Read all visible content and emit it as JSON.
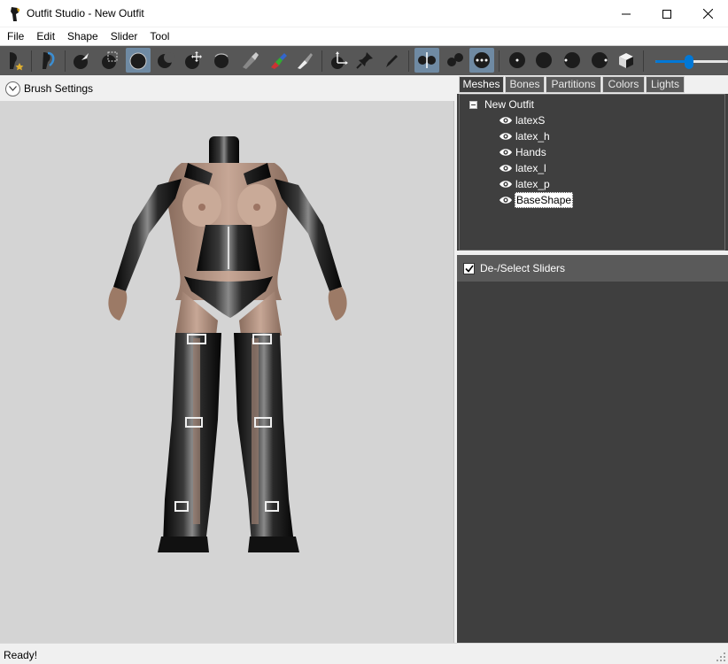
{
  "window": {
    "title": "Outfit Studio - New Outfit"
  },
  "menu": [
    "File",
    "Edit",
    "Shape",
    "Slider",
    "Tool"
  ],
  "toolbar": {
    "tools": [
      {
        "name": "select-brush-tool",
        "icon": "brush-star-icon",
        "active": false
      },
      {
        "name": "transform-brush-tool",
        "icon": "brush-curve-icon",
        "active": false
      },
      {
        "name": "push-tool",
        "icon": "push-arrow-icon",
        "active": false
      },
      {
        "name": "mask-tool",
        "icon": "mask-square-icon",
        "active": false
      },
      {
        "name": "inflate-tool",
        "icon": "inflate-icon",
        "active": true
      },
      {
        "name": "deflate-tool",
        "icon": "deflate-icon",
        "active": false
      },
      {
        "name": "move-tool",
        "icon": "move-arrows-icon",
        "active": false
      },
      {
        "name": "smooth-tool",
        "icon": "smooth-icon",
        "active": false
      },
      {
        "name": "weight-tool",
        "icon": "weight-paint-icon",
        "active": false
      },
      {
        "name": "color-tool",
        "icon": "color-paint-icon",
        "active": false
      },
      {
        "name": "alpha-tool",
        "icon": "alpha-brush-icon",
        "active": false
      },
      {
        "name": "transform-tool",
        "icon": "axes-transform-icon",
        "active": false
      },
      {
        "name": "pivot-tool",
        "icon": "pin-icon",
        "active": false
      },
      {
        "name": "pen-tool",
        "icon": "pen-icon",
        "active": false
      },
      {
        "name": "x-mirror-toggle",
        "icon": "mirror-icon",
        "active": true
      },
      {
        "name": "connected-toggle",
        "icon": "connected-icon",
        "active": false
      },
      {
        "name": "vertex-toggle",
        "icon": "vertex-dots-icon",
        "active": true
      },
      {
        "name": "view-front-button",
        "icon": "view-front-icon",
        "active": false
      },
      {
        "name": "view-back-button",
        "icon": "view-back-icon",
        "active": false
      },
      {
        "name": "view-left-button",
        "icon": "view-left-icon",
        "active": false
      },
      {
        "name": "view-right-button",
        "icon": "view-right-icon",
        "active": false
      },
      {
        "name": "view-perspective-button",
        "icon": "cube-icon",
        "active": false
      }
    ],
    "brush_size": 0.46
  },
  "brush_settings": {
    "label": "Brush Settings"
  },
  "tabs": [
    "Meshes",
    "Bones",
    "Partitions",
    "Colors",
    "Lights"
  ],
  "active_tab": "Meshes",
  "meshes": {
    "root": "New Outfit",
    "items": [
      {
        "name": "latexS",
        "selected": false
      },
      {
        "name": "latex_h",
        "selected": false
      },
      {
        "name": "Hands",
        "selected": false
      },
      {
        "name": "latex_l",
        "selected": false
      },
      {
        "name": "latex_p",
        "selected": false
      },
      {
        "name": "BaseShape",
        "selected": true
      }
    ]
  },
  "sliders": {
    "header": "De-/Select Sliders"
  },
  "status": {
    "text": "Ready!"
  }
}
